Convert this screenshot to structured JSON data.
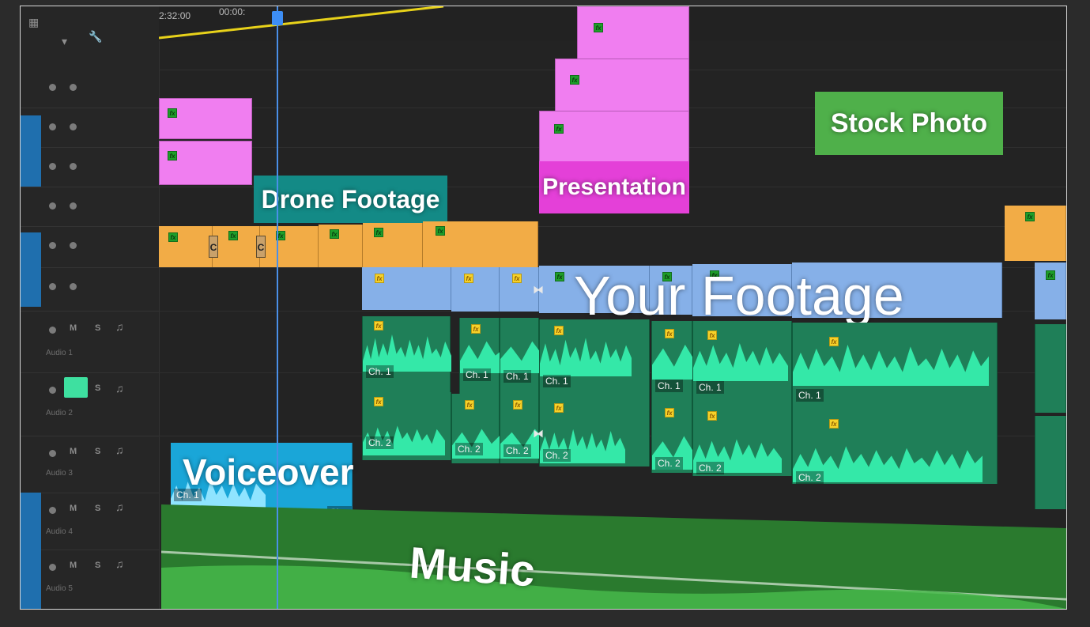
{
  "ruler": {
    "timecode_left": "2:32:00",
    "timecode_mid": "00:00:"
  },
  "track_header": {
    "toolbar_icons": [
      "wrench-icon",
      "marker-icon",
      "snap-icon"
    ],
    "audio_labels": [
      "Audio 1",
      "Audio 2",
      "Audio 3",
      "Audio 4",
      "Audio 5"
    ],
    "mute_glyph": "M",
    "solo_glyph": "S"
  },
  "labels": {
    "drone": "Drone Footage",
    "presentation": "Presentation",
    "stock": "Stock Photo",
    "footage": "Your Footage",
    "voiceover": "Voiceover",
    "music": "Music"
  },
  "clip_text": {
    "fx": "fx",
    "ch1": "Ch. 1",
    "ch2": "Ch. 2",
    "c_marker": "C"
  },
  "colors": {
    "playhead": "#4a8fe8",
    "video_pink": "#f07ef0",
    "video_orange": "#f2ac46",
    "video_blue": "#86b0e8",
    "audio_green": "#1f7f58",
    "waveform": "#34e8a8",
    "music": "#2a7a2e",
    "voiceover": "#1aa6d8"
  }
}
